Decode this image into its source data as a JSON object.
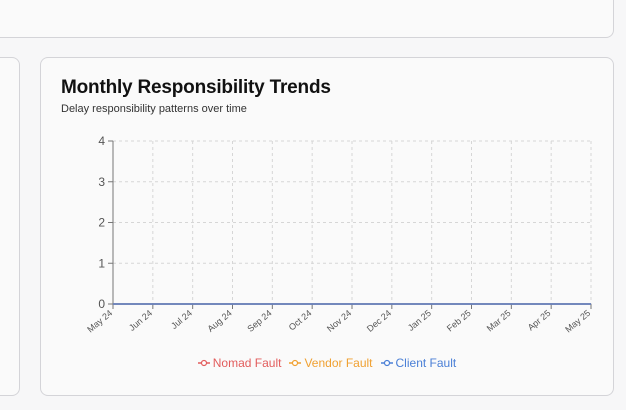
{
  "card": {
    "title": "Monthly Responsibility Trends",
    "subtitle": "Delay responsibility patterns over time"
  },
  "chart_data": {
    "type": "line",
    "x": [
      "May 24",
      "Jun 24",
      "Jul 24",
      "Aug 24",
      "Sep 24",
      "Oct 24",
      "Nov 24",
      "Dec 24",
      "Jan 25",
      "Feb 25",
      "Mar 25",
      "Apr 25",
      "May 25"
    ],
    "ylim": [
      0,
      4
    ],
    "yticks": [
      0,
      1,
      2,
      3,
      4
    ],
    "grid": true,
    "legend": "bottom",
    "series": [
      {
        "name": "Nomad Fault",
        "color": "#e25c5c",
        "values": [
          0,
          0,
          0,
          0,
          0,
          0,
          0,
          0,
          0,
          0,
          0,
          0,
          0
        ]
      },
      {
        "name": "Vendor Fault",
        "color": "#f0a030",
        "values": [
          0,
          0,
          0,
          0,
          0,
          0,
          0,
          0,
          0,
          0,
          0,
          0,
          0
        ]
      },
      {
        "name": "Client Fault",
        "color": "#4a7fd6",
        "values": [
          0,
          0,
          0,
          0,
          0,
          0,
          0,
          0,
          0,
          0,
          0,
          0,
          0
        ]
      }
    ]
  }
}
